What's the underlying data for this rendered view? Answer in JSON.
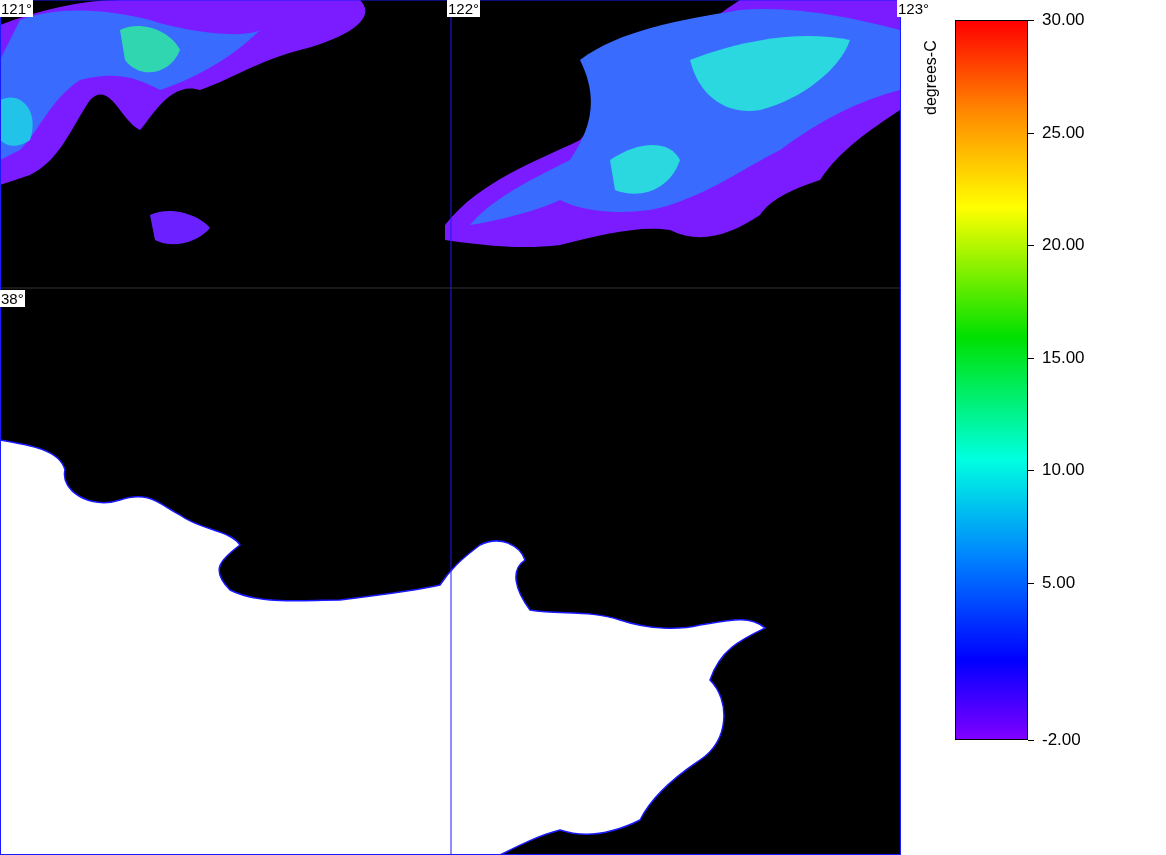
{
  "map": {
    "longitude_labels": [
      "121°",
      "122°",
      "123°"
    ],
    "latitude_labels": [
      "38°"
    ]
  },
  "legend": {
    "title": "degrees-C",
    "ticks": [
      "30.00",
      "25.00",
      "20.00",
      "15.00",
      "10.00",
      "5.00",
      "-2.00"
    ]
  }
}
